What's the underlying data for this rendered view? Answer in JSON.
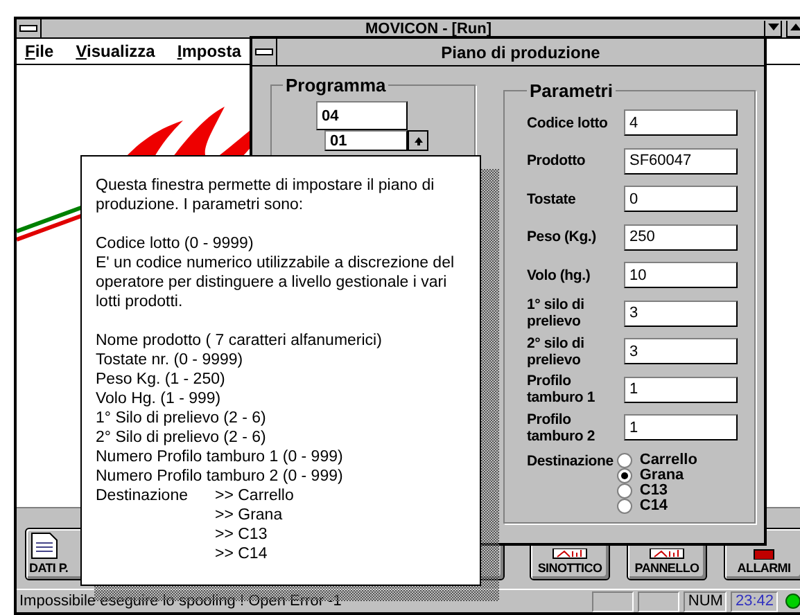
{
  "main_window": {
    "title": "MOVICON - [Run]"
  },
  "menu": [
    {
      "label": "File"
    },
    {
      "label": "Visualizza"
    },
    {
      "label": "Imposta"
    }
  ],
  "dialog": {
    "title": "Piano di produzione",
    "programma": {
      "title": "Programma",
      "program_value": "04",
      "step_value": "01"
    },
    "parametri": {
      "title": "Parametri",
      "fields": [
        {
          "label": "Codice lotto",
          "value": "4"
        },
        {
          "label": "Prodotto",
          "value": "SF60047"
        },
        {
          "label": "Tostate",
          "value": "0"
        },
        {
          "label": "Peso (Kg.)",
          "value": "250"
        },
        {
          "label": "Volo (hg.)",
          "value": "10"
        },
        {
          "label": "1° silo di prelievo",
          "value": "3"
        },
        {
          "label": "2° silo di prelievo",
          "value": "3"
        },
        {
          "label": "Profilo tamburo 1",
          "value": "1"
        },
        {
          "label": "Profilo tamburo 2",
          "value": "1"
        }
      ],
      "destination": {
        "label": "Destinazione",
        "options": [
          {
            "label": "Carrello",
            "selected": false
          },
          {
            "label": "Grana",
            "selected": true
          },
          {
            "label": "C13",
            "selected": false
          },
          {
            "label": "C14",
            "selected": false
          }
        ]
      }
    }
  },
  "help_popup": {
    "paragraphs": [
      [
        {
          "kind": "text",
          "text": "Questa finestra permette di impostare il piano di produzione. I parametri sono:"
        }
      ],
      [
        {
          "kind": "text",
          "text": "Codice lotto (0 - 9999)"
        },
        {
          "kind": "text",
          "text": "E' un codice numerico utilizzabile a discrezione del operatore  per distinguere a  livello gestionale i vari lotti prodotti."
        }
      ],
      [
        {
          "kind": "text",
          "text": "Nome prodotto  ( 7 caratteri alfanumerici)"
        },
        {
          "kind": "text",
          "text": "Tostate nr.  (0 - 9999)"
        },
        {
          "kind": "text",
          "text": "Peso Kg. (1 - 250)"
        },
        {
          "kind": "text",
          "text": "Volo  Hg. (1 - 999)"
        },
        {
          "kind": "text",
          "text": "1° Silo di prelievo (2 - 6)"
        },
        {
          "kind": "text",
          "text": "2° Silo di prelievo (2 - 6)"
        },
        {
          "kind": "text",
          "text": "Numero Profilo tamburo 1 (0 - 999)"
        },
        {
          "kind": "text",
          "text": "Numero Profilo tamburo 2 (0 - 999)"
        },
        {
          "kind": "lead",
          "lead": "Destinazione",
          "text": ">> Carrello"
        },
        {
          "kind": "option",
          "text": ">> Grana"
        },
        {
          "kind": "option",
          "text": ">> C13"
        },
        {
          "kind": "option",
          "text": ">> C14"
        }
      ]
    ]
  },
  "toolbar": [
    {
      "label": "DATI P."
    },
    {
      "label": "SINOTTICO"
    },
    {
      "label": "PANNELLO"
    },
    {
      "label": "ALLARMI"
    }
  ],
  "status_bar": {
    "message": "Impossibile eseguire lo spooling ! Open Error -1",
    "keyboard": "NUM",
    "time": "23:42"
  }
}
